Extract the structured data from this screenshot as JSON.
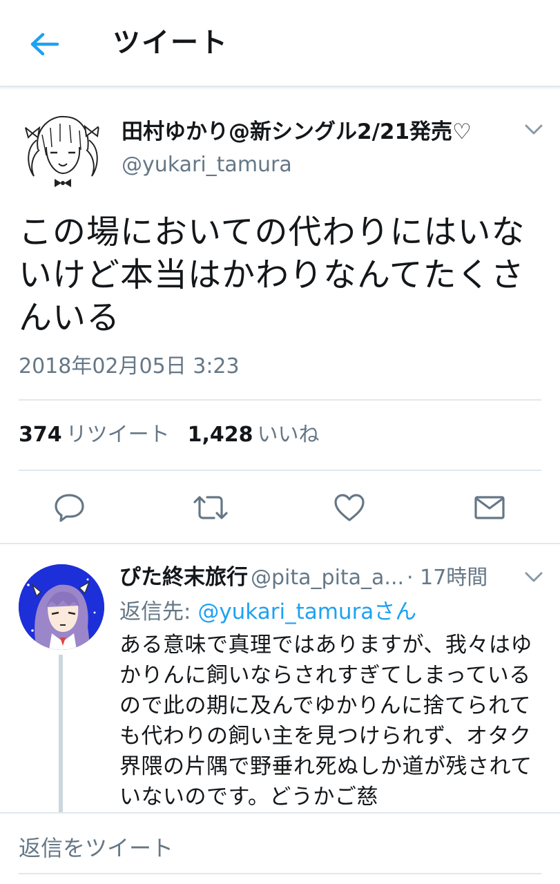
{
  "header": {
    "title": "ツイート",
    "back_icon": "arrow-left-icon"
  },
  "colors": {
    "accent": "#1da1f2",
    "secondary_text": "#657786",
    "divider": "#e1e8ed"
  },
  "tweet": {
    "display_name": "田村ゆかり@新シングル2/21発売♡",
    "handle": "@yukari_tamura",
    "text": "この場においての代わりにはいないけど本当はかわりなんてたくさんいる",
    "timestamp": "2018年02月05日 3:23",
    "retweet_count": "374",
    "retweet_label": "リツイート",
    "like_count": "1,428",
    "like_label": "いいね",
    "actions": [
      "reply-icon",
      "retweet-icon",
      "like-icon",
      "dm-icon"
    ]
  },
  "reply": {
    "display_name": "ぴた終末旅行",
    "handle": "@pita_pita_a...",
    "time": "· 17時間",
    "reply_to_prefix": "返信先: ",
    "reply_to_link": "@yukari_tamuraさん",
    "text": "ある意味で真理ではありますが、我々はゆかりんに飼いならされすぎてしまっているので此の期に及んでゆかりんに捨てられても代わりの飼い主を見つけられず、オタク界隈の片隅で野垂れ死ぬしか道が残されていないのです。どうかご慈"
  },
  "compose": {
    "placeholder": "返信をツイート"
  }
}
